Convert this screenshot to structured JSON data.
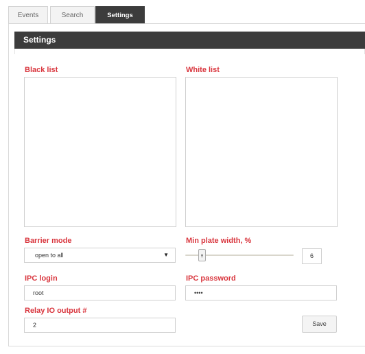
{
  "tabs": [
    {
      "label": "Events"
    },
    {
      "label": "Search"
    },
    {
      "label": "Settings",
      "active": true
    }
  ],
  "panel": {
    "title": "Settings"
  },
  "black_list": {
    "label": "Black list"
  },
  "white_list": {
    "label": "White list"
  },
  "barrier_mode": {
    "label": "Barrier mode",
    "selected": "open to all"
  },
  "min_plate_width": {
    "label": "Min plate width, %",
    "value": "6"
  },
  "ipc_login": {
    "label": "IPC login",
    "value": "root"
  },
  "ipc_password": {
    "label": "IPC password",
    "value": "••••"
  },
  "relay": {
    "label": "Relay IO output #",
    "value": "2"
  },
  "save_label": "Save",
  "colors": {
    "accent_label": "#d9363e",
    "header_bg": "#3c3c3c"
  }
}
